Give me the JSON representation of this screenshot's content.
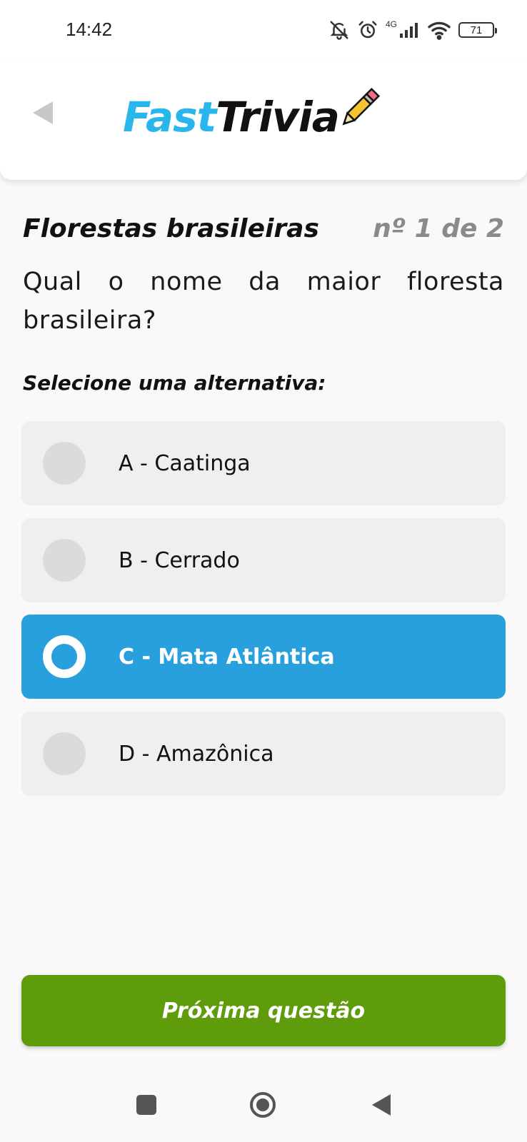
{
  "status_bar": {
    "time": "14:42",
    "network_label": "4G",
    "battery": "71",
    "icons": [
      "bell-off-icon",
      "alarm-icon",
      "signal-icon",
      "wifi-icon",
      "battery-icon"
    ]
  },
  "header": {
    "logo_part1": "Fast",
    "logo_part2": "Trivia",
    "back_icon": "back-triangle-icon"
  },
  "quiz": {
    "title": "Florestas brasileiras",
    "counter": "nº 1 de 2",
    "question": "Qual o nome da maior floresta brasileira?",
    "select_label": "Selecione uma alternativa:",
    "options": [
      {
        "label": "A - Caatinga",
        "selected": false
      },
      {
        "label": "B - Cerrado",
        "selected": false
      },
      {
        "label": "C - Mata Atlântica",
        "selected": true
      },
      {
        "label": "D - Amazônica",
        "selected": false
      }
    ],
    "next_button": "Próxima questão"
  },
  "colors": {
    "accent_blue": "#27a0dd",
    "logo_blue": "#29b6ec",
    "next_green": "#5f9c0b",
    "option_bg": "#efefef"
  },
  "nav_bar": {
    "icons": [
      "recents-square-icon",
      "home-circle-icon",
      "back-triangle-icon"
    ]
  }
}
